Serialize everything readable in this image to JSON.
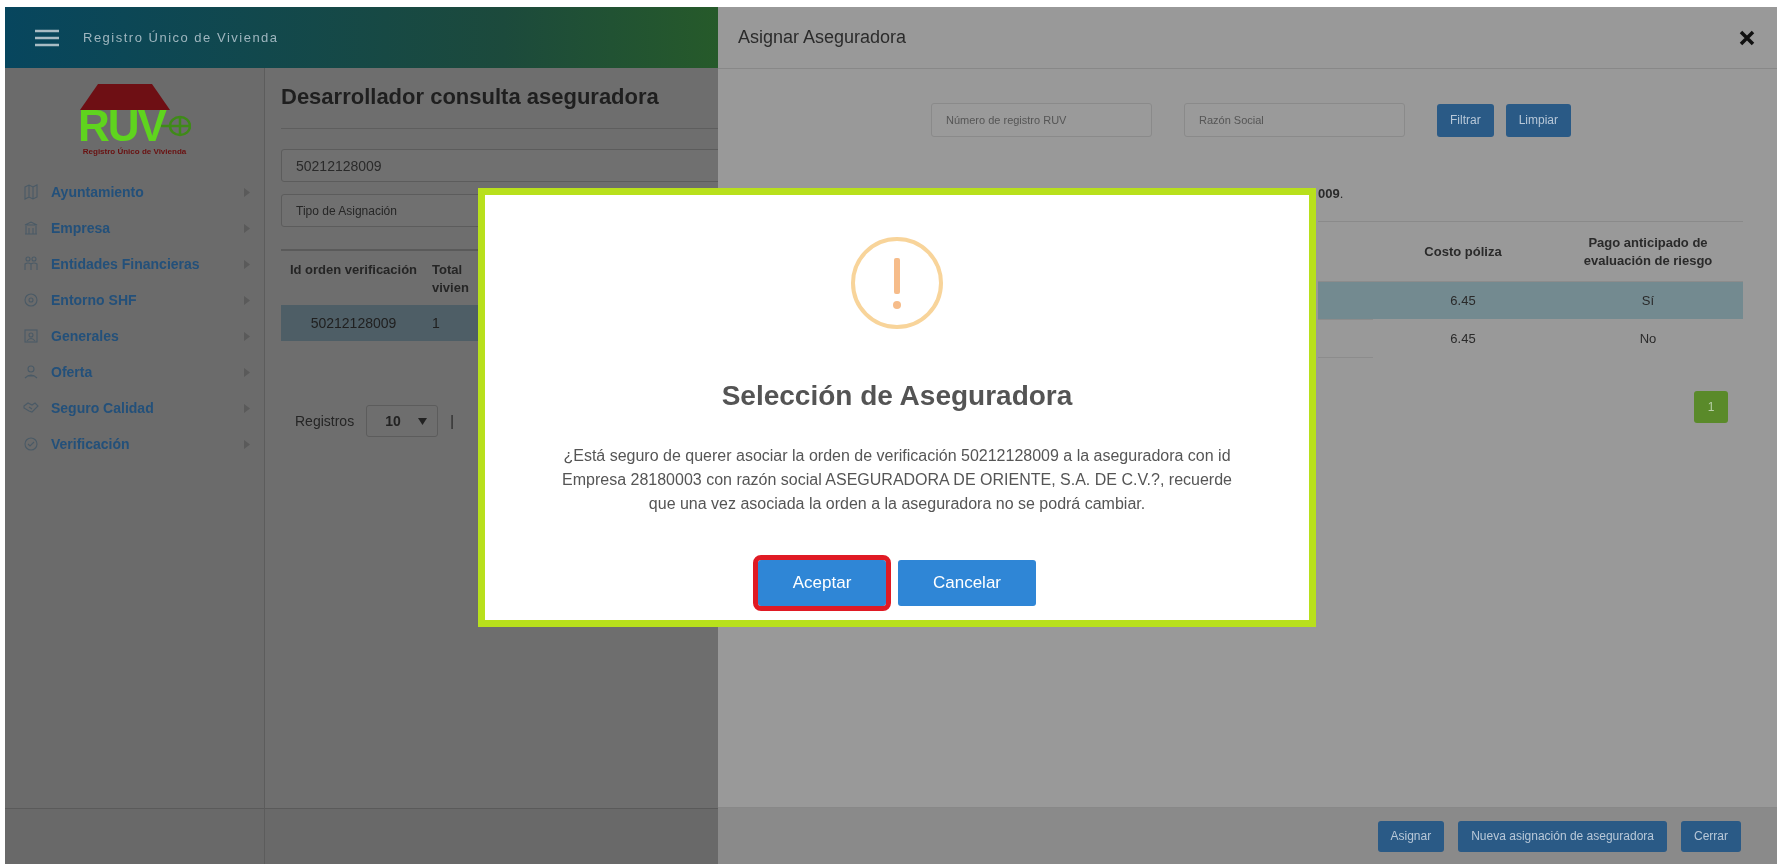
{
  "header": {
    "title": "Registro Único de Vivienda"
  },
  "sidebar": {
    "logo": {
      "text": "RUV",
      "subtitle": "Registro Único de Vivienda"
    },
    "items": [
      {
        "label": "Ayuntamiento"
      },
      {
        "label": "Empresa"
      },
      {
        "label": "Entidades Financieras"
      },
      {
        "label": "Entorno SHF"
      },
      {
        "label": "Generales"
      },
      {
        "label": "Oferta"
      },
      {
        "label": "Seguro Calidad"
      },
      {
        "label": "Verificación"
      }
    ]
  },
  "main": {
    "title": "Desarrollador consulta aseguradora",
    "search_value": "50212128009",
    "type_placeholder": "Tipo de Asignación",
    "table": {
      "columns": [
        "Id orden verificación",
        "Total vivien"
      ],
      "rows": [
        {
          "cells": [
            "50212128009",
            "1"
          ],
          "selected": true
        }
      ]
    },
    "registros_label": "Registros",
    "page_size": "10",
    "separator": "|"
  },
  "panel": {
    "title": "Asignar Aseguradora",
    "filters": [
      {
        "placeholder": "Número de registro RUV"
      },
      {
        "placeholder": "Razón Social"
      }
    ],
    "filter_buttons": [
      "Filtrar",
      "Limpiar"
    ],
    "note": "**009**.",
    "table": {
      "columns": [
        "Costo póliza",
        "Pago anticipado de evaluación de riesgo"
      ],
      "rows": [
        {
          "cells": [
            "6.45",
            "Sí"
          ],
          "selected": true
        },
        {
          "cells": [
            "6.45",
            "No"
          ],
          "selected": false
        }
      ]
    },
    "pagination": [
      {
        "label": "1",
        "selected": true
      }
    ],
    "footer_buttons": [
      "Asignar",
      "Nueva asignación de aseguradora",
      "Cerrar"
    ]
  },
  "dialog": {
    "title": "Selección de Aseguradora",
    "message": "¿Está seguro de querer asociar la orden de verificación 50212128009 a la aseguradora con id Empresa 28180003 con razón social ASEGURADORA DE ORIENTE, S.A. DE C.V.?, recuerde que una vez asociada la orden a la aseguradora no se podrá cambiar.",
    "buttons": [
      {
        "label": "Aceptar",
        "focused": true
      },
      {
        "label": "Cancelar",
        "focused": false
      }
    ]
  }
}
